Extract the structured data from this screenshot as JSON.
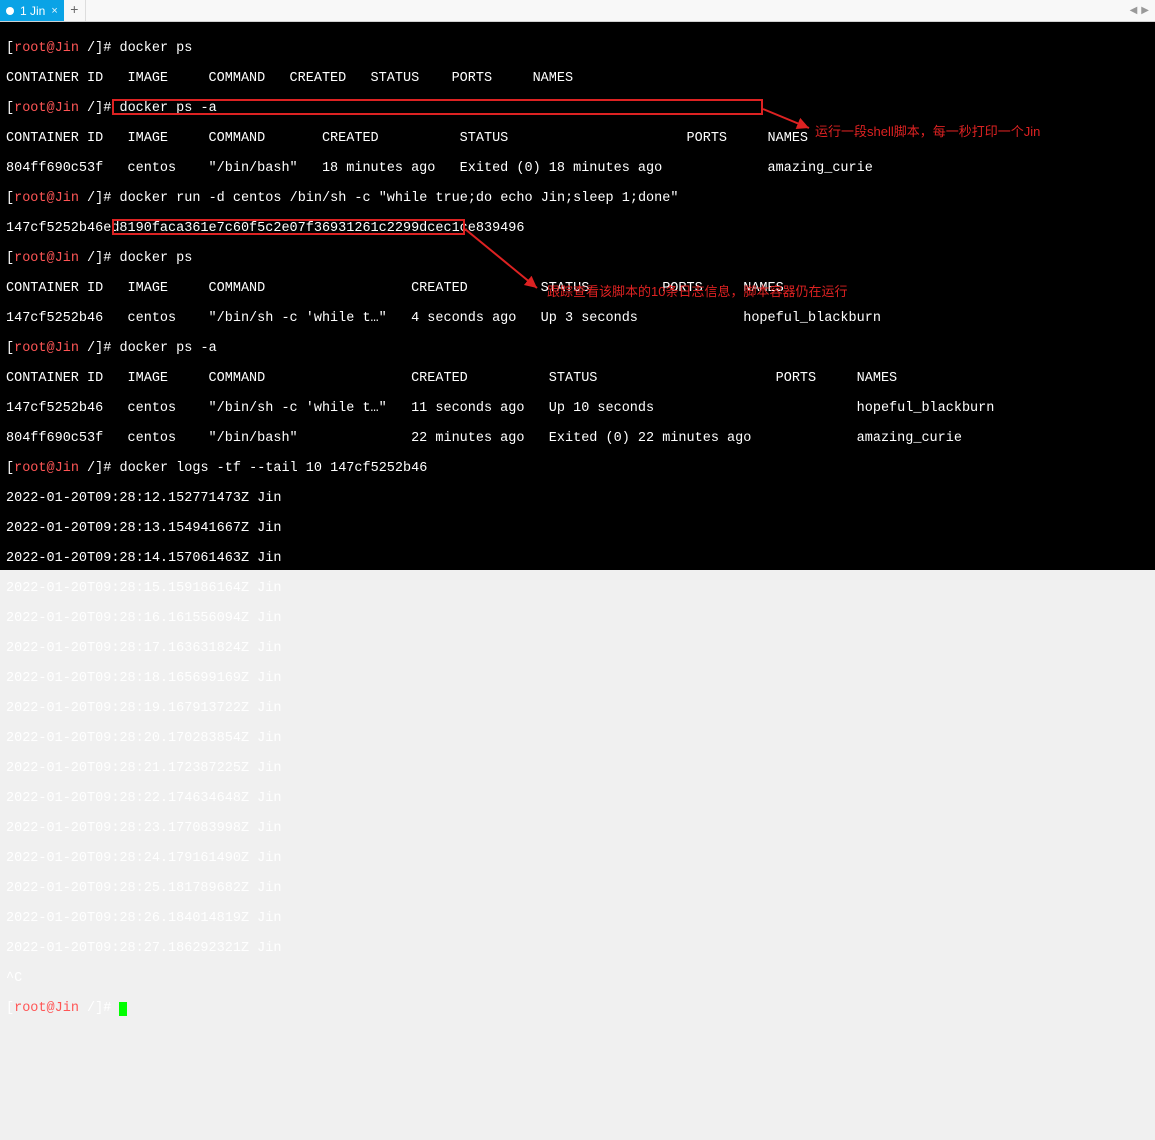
{
  "tab": {
    "label": "1 Jin",
    "close": "×",
    "new": "+"
  },
  "prompt": {
    "user": "root",
    "at": "@",
    "host": "Jin",
    "path": "/",
    "end": "]# "
  },
  "cmds": {
    "ps": "docker ps",
    "psa": "docker ps -a",
    "run": "docker run -d centos /bin/sh -c \"while true;do echo Jin;sleep 1;done\"",
    "runout": "147cf5252b46ed8190faca361e7c60f5c2e07f36931261c2299dcec1ce839496",
    "logs": "docker logs -tf --tail 10 147cf5252b46"
  },
  "hdr1": "CONTAINER ID   IMAGE     COMMAND   CREATED   STATUS    PORTS     NAMES",
  "hdr2": "CONTAINER ID   IMAGE     COMMAND       CREATED          STATUS                      PORTS     NAMES",
  "row804": "804ff690c53f   centos    \"/bin/bash\"   18 minutes ago   Exited (0) 18 minutes ago             amazing_curie",
  "hdr3": "CONTAINER ID   IMAGE     COMMAND                  CREATED         STATUS         PORTS     NAMES",
  "row147a": "147cf5252b46   centos    \"/bin/sh -c 'while t…\"   4 seconds ago   Up 3 seconds             hopeful_blackburn",
  "hdr4": "CONTAINER ID   IMAGE     COMMAND                  CREATED          STATUS                      PORTS     NAMES",
  "row147b": "147cf5252b46   centos    \"/bin/sh -c 'while t…\"   11 seconds ago   Up 10 seconds                         hopeful_blackburn",
  "row804b": "804ff690c53f   centos    \"/bin/bash\"              22 minutes ago   Exited (0) 22 minutes ago             amazing_curie",
  "loglines": [
    "2022-01-20T09:28:12.152771473Z Jin",
    "2022-01-20T09:28:13.154941667Z Jin",
    "2022-01-20T09:28:14.157061463Z Jin",
    "2022-01-20T09:28:15.159186164Z Jin",
    "2022-01-20T09:28:16.161556094Z Jin",
    "2022-01-20T09:28:17.163631824Z Jin",
    "2022-01-20T09:28:18.165699169Z Jin",
    "2022-01-20T09:28:19.167913722Z Jin",
    "2022-01-20T09:28:20.170283854Z Jin",
    "2022-01-20T09:28:21.172387225Z Jin",
    "2022-01-20T09:28:22.174634648Z Jin",
    "2022-01-20T09:28:23.177083998Z Jin",
    "2022-01-20T09:28:24.179161490Z Jin",
    "2022-01-20T09:28:25.181789682Z Jin",
    "2022-01-20T09:28:26.184014819Z Jin",
    "2022-01-20T09:28:27.186292321Z Jin"
  ],
  "ctrlc": "^C",
  "annot1": "运行一段shell脚本，每一秒打印一个Jin",
  "annot2": "跟踪查看该脚本的10条日志信息，脚本容器仍在运行"
}
